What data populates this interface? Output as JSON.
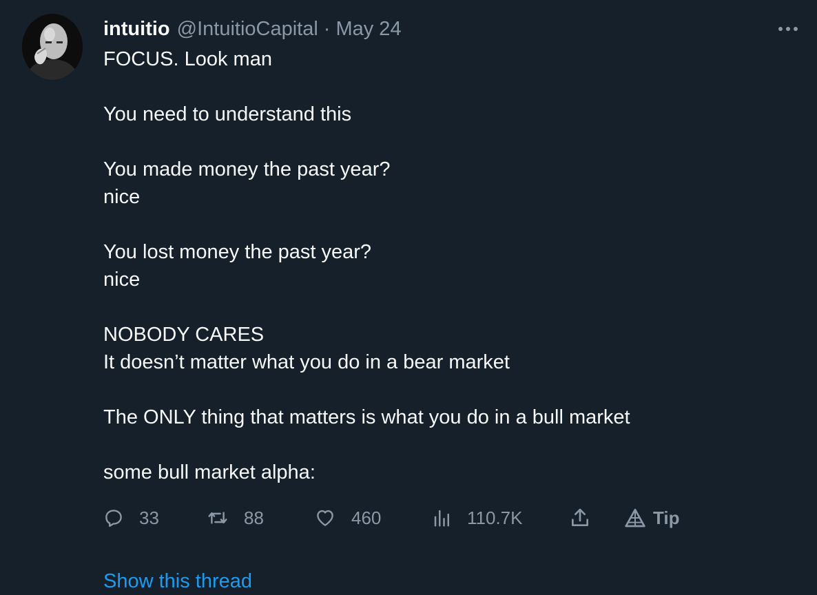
{
  "tweet": {
    "author": {
      "display_name": "intuitio",
      "handle": "@IntuitioCapital",
      "separator": "·",
      "date": "May 24"
    },
    "more_icon": "more-horizontal-icon",
    "lines": [
      "FOCUS. Look man",
      "",
      "You need to understand this",
      "",
      "You made money the past year?",
      "nice",
      "",
      "You lost money the past year?",
      "nice",
      "",
      "NOBODY CARES",
      "It doesn’t matter what you do in a bear market",
      "",
      "The ONLY thing that matters is what you do in a bull market",
      "",
      "some bull market alpha:"
    ],
    "actions": {
      "reply": {
        "icon": "reply-icon",
        "count": "33"
      },
      "retweet": {
        "icon": "retweet-icon",
        "count": "88"
      },
      "like": {
        "icon": "heart-icon",
        "count": "460"
      },
      "views": {
        "icon": "analytics-icon",
        "count": "110.7K"
      },
      "share": {
        "icon": "share-icon"
      },
      "tip": {
        "icon": "tip-icon",
        "label": "Tip"
      }
    },
    "show_thread": "Show this thread"
  },
  "colors": {
    "background": "#15202b",
    "text": "#f7f9f9",
    "muted": "#8b98a5",
    "link": "#1d9bf0"
  }
}
